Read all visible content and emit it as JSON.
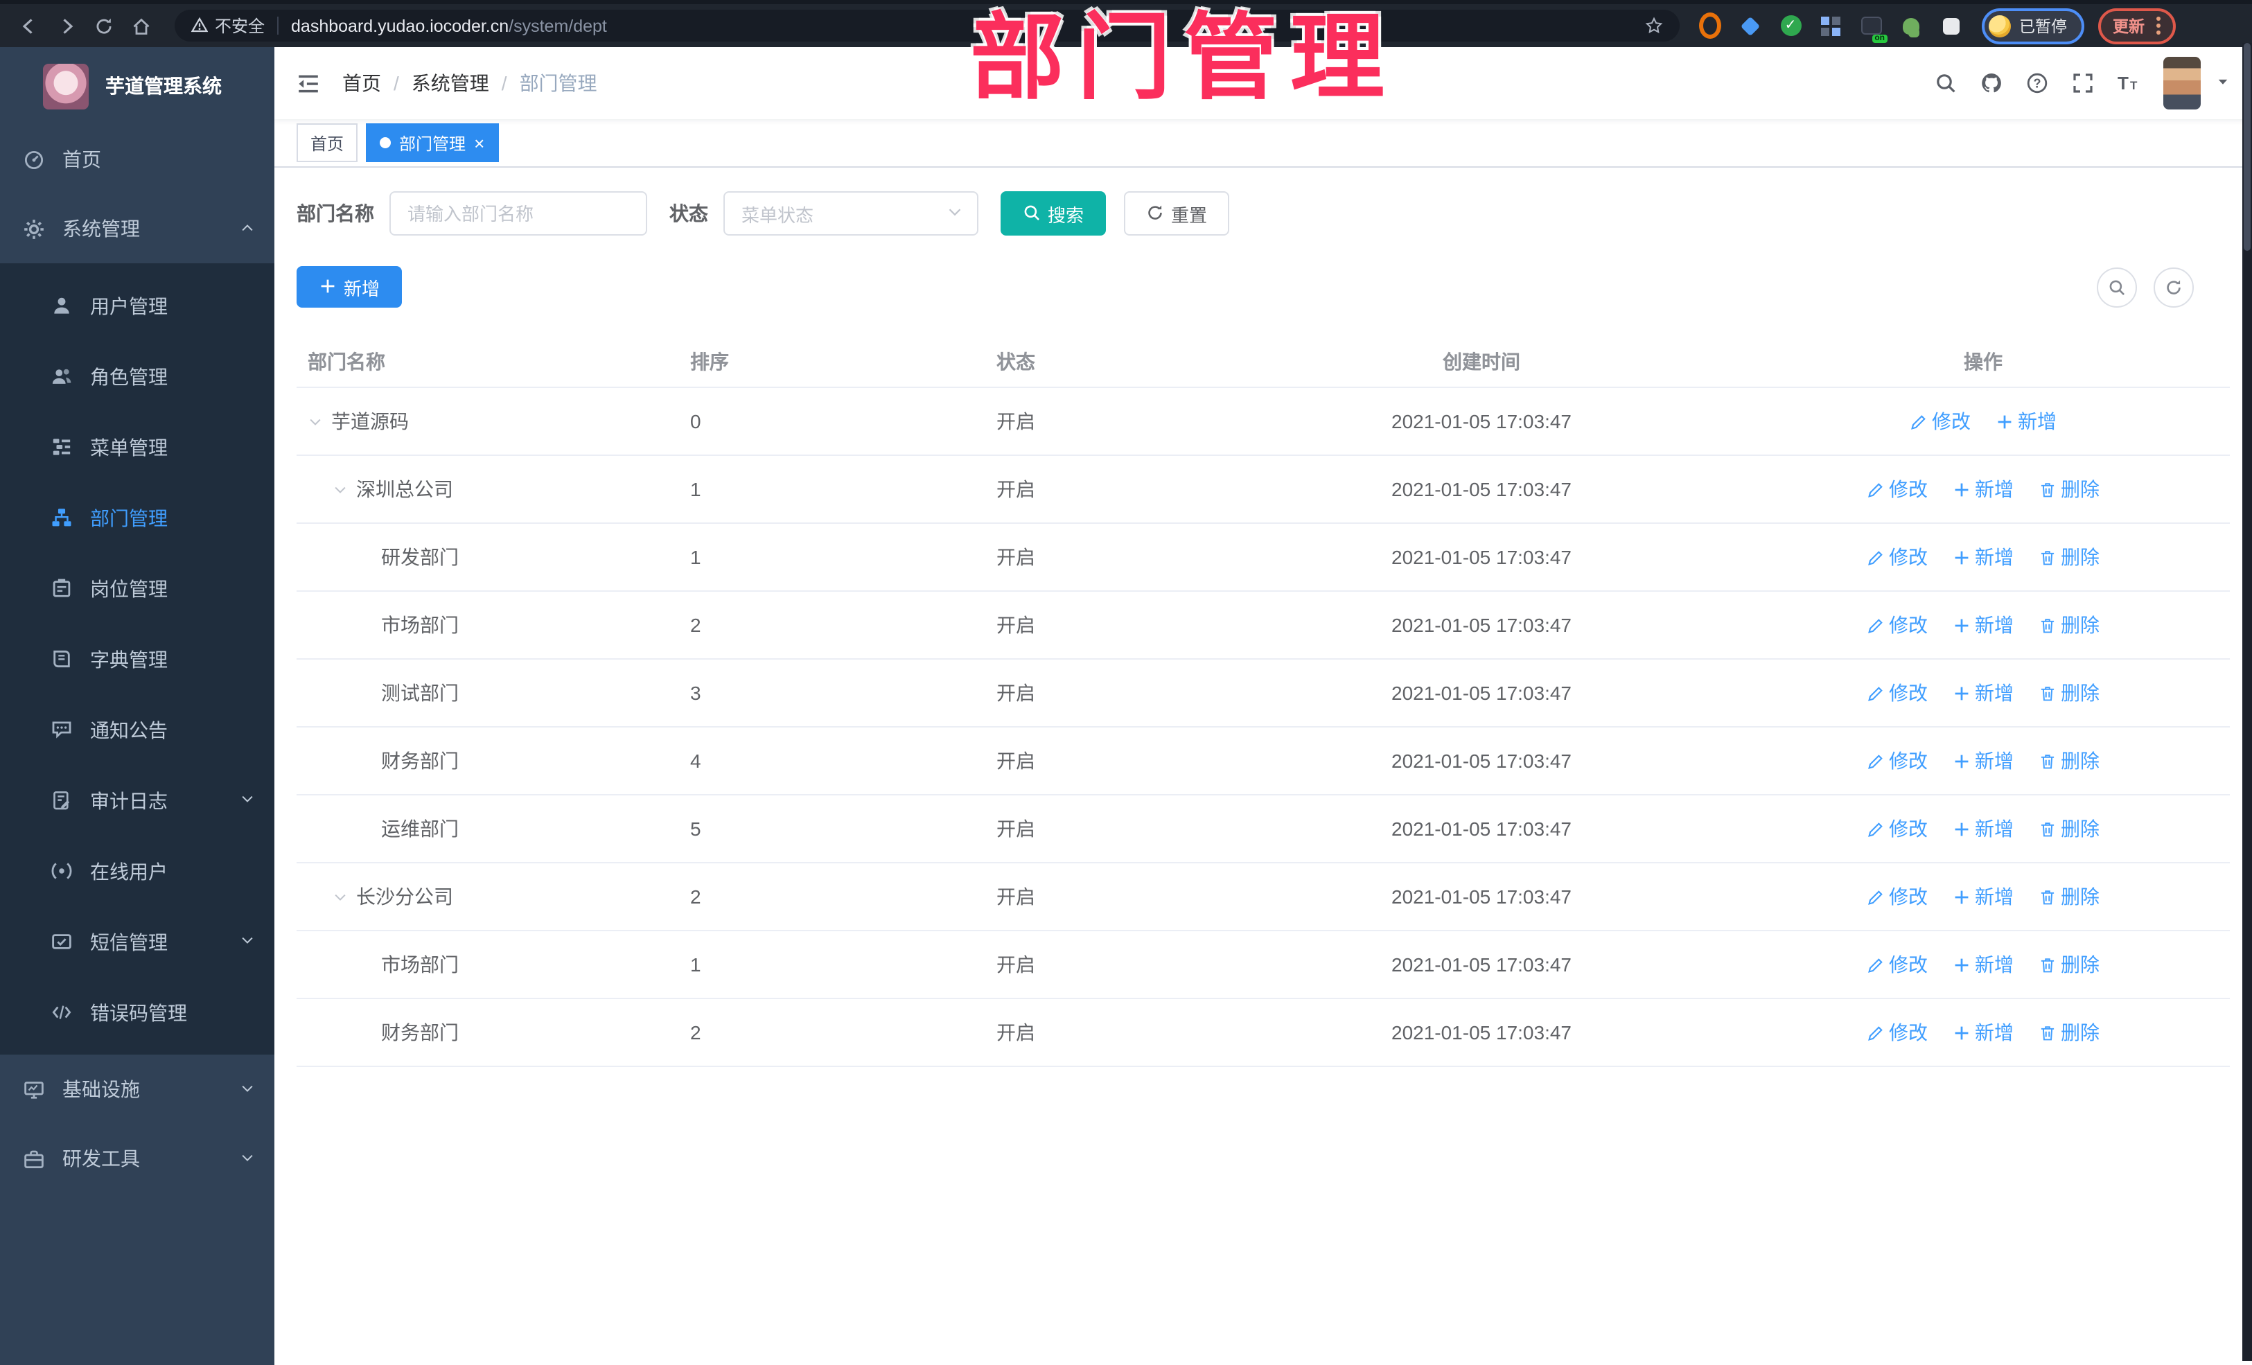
{
  "browser": {
    "security_text": "不安全",
    "url_host": "dashboard.yudao.iocoder.cn",
    "url_path": "/system/dept",
    "profile_status": "已暂停",
    "update_label": "更新",
    "extensions": [
      {
        "name": "extension-orange-ring",
        "shape": "ring",
        "color": "#e8710a"
      },
      {
        "name": "extension-blue-gem",
        "shape": "diamond",
        "color": "#4a9af5"
      },
      {
        "name": "extension-green-check",
        "shape": "check",
        "color": "#2fa84f"
      },
      {
        "name": "extension-grid",
        "shape": "grid",
        "color": "#8ab4f8"
      },
      {
        "name": "extension-on-badge",
        "shape": "onbadge",
        "color": "#2b313d",
        "badge": "on",
        "badge_color": "#27c93f"
      },
      {
        "name": "extension-key",
        "shape": "key",
        "color": "#6fae5e"
      },
      {
        "name": "extension-puzzle",
        "shape": "puzzle",
        "color": "#e8eaed"
      }
    ]
  },
  "annotation": {
    "text": "部门管理",
    "color": "#fb2e5c"
  },
  "sidebar": {
    "logo_title": "芋道管理系统",
    "menu": [
      {
        "key": "home",
        "label": "首页",
        "icon": "dashboard-icon"
      },
      {
        "key": "system",
        "label": "系统管理",
        "icon": "gear-icon",
        "expanded": true,
        "children": [
          {
            "key": "user",
            "label": "用户管理",
            "icon": "user-icon"
          },
          {
            "key": "role",
            "label": "角色管理",
            "icon": "users-icon"
          },
          {
            "key": "menu",
            "label": "菜单管理",
            "icon": "menu-tree-icon"
          },
          {
            "key": "dept",
            "label": "部门管理",
            "icon": "org-icon",
            "active": true
          },
          {
            "key": "post",
            "label": "岗位管理",
            "icon": "badge-icon"
          },
          {
            "key": "dict",
            "label": "字典管理",
            "icon": "book-icon"
          },
          {
            "key": "notice",
            "label": "通知公告",
            "icon": "announcement-icon"
          },
          {
            "key": "audit-log",
            "label": "审计日志",
            "icon": "audit-icon",
            "collapsed": true
          },
          {
            "key": "online-user",
            "label": "在线用户",
            "icon": "online-icon"
          },
          {
            "key": "sms",
            "label": "短信管理",
            "icon": "sms-icon",
            "collapsed": true
          },
          {
            "key": "error-code",
            "label": "错误码管理",
            "icon": "code-icon"
          }
        ]
      },
      {
        "key": "infra",
        "label": "基础设施",
        "icon": "infra-icon",
        "collapsed": true
      },
      {
        "key": "dev-tools",
        "label": "研发工具",
        "icon": "tools-icon",
        "collapsed": true
      }
    ]
  },
  "navbar": {
    "breadcrumb": [
      "首页",
      "系统管理",
      "部门管理"
    ]
  },
  "tags": [
    {
      "label": "首页",
      "active": false,
      "closable": false
    },
    {
      "label": "部门管理",
      "active": true,
      "closable": true
    }
  ],
  "filter": {
    "dept_label": "部门名称",
    "dept_placeholder": "请输入部门名称",
    "status_label": "状态",
    "status_placeholder": "菜单状态",
    "search_label": "搜索",
    "reset_label": "重置"
  },
  "toolbar": {
    "add_label": "新增"
  },
  "table": {
    "columns": [
      "部门名称",
      "排序",
      "状态",
      "创建时间",
      "操作"
    ],
    "action_labels": {
      "edit": "修改",
      "add": "新增",
      "delete": "删除"
    },
    "rows": [
      {
        "name": "芋道源码",
        "level": 0,
        "expandable": true,
        "sort": "0",
        "status": "开启",
        "created": "2021-01-05 17:03:47",
        "actions": [
          "edit",
          "add"
        ]
      },
      {
        "name": "深圳总公司",
        "level": 1,
        "expandable": true,
        "sort": "1",
        "status": "开启",
        "created": "2021-01-05 17:03:47",
        "actions": [
          "edit",
          "add",
          "delete"
        ]
      },
      {
        "name": "研发部门",
        "level": 2,
        "expandable": false,
        "sort": "1",
        "status": "开启",
        "created": "2021-01-05 17:03:47",
        "actions": [
          "edit",
          "add",
          "delete"
        ]
      },
      {
        "name": "市场部门",
        "level": 2,
        "expandable": false,
        "sort": "2",
        "status": "开启",
        "created": "2021-01-05 17:03:47",
        "actions": [
          "edit",
          "add",
          "delete"
        ]
      },
      {
        "name": "测试部门",
        "level": 2,
        "expandable": false,
        "sort": "3",
        "status": "开启",
        "created": "2021-01-05 17:03:47",
        "actions": [
          "edit",
          "add",
          "delete"
        ]
      },
      {
        "name": "财务部门",
        "level": 2,
        "expandable": false,
        "sort": "4",
        "status": "开启",
        "created": "2021-01-05 17:03:47",
        "actions": [
          "edit",
          "add",
          "delete"
        ]
      },
      {
        "name": "运维部门",
        "level": 2,
        "expandable": false,
        "sort": "5",
        "status": "开启",
        "created": "2021-01-05 17:03:47",
        "actions": [
          "edit",
          "add",
          "delete"
        ]
      },
      {
        "name": "长沙分公司",
        "level": 1,
        "expandable": true,
        "sort": "2",
        "status": "开启",
        "created": "2021-01-05 17:03:47",
        "actions": [
          "edit",
          "add",
          "delete"
        ]
      },
      {
        "name": "市场部门",
        "level": 2,
        "expandable": false,
        "sort": "1",
        "status": "开启",
        "created": "2021-01-05 17:03:47",
        "actions": [
          "edit",
          "add",
          "delete"
        ]
      },
      {
        "name": "财务部门",
        "level": 2,
        "expandable": false,
        "sort": "2",
        "status": "开启",
        "created": "2021-01-05 17:03:47",
        "actions": [
          "edit",
          "add",
          "delete"
        ]
      }
    ]
  },
  "colors": {
    "primary_blue": "#2d8cf0",
    "link_blue": "#409eff",
    "search_teal": "#0fb3a7",
    "sidebar_bg": "#304156",
    "submenu_bg": "#1f2d3d",
    "annotation_pink": "#fb2e5c"
  }
}
